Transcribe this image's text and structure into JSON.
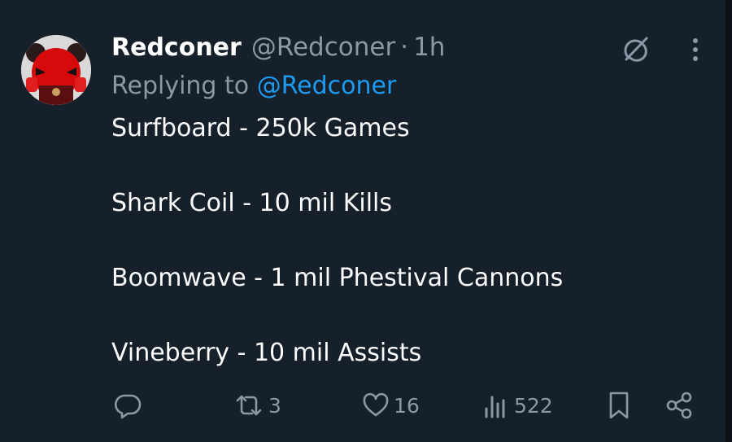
{
  "post": {
    "display_name": "Redconer",
    "handle": "@Redconer",
    "separator": "·",
    "time": "1h",
    "reply_prefix": "Replying to",
    "reply_handle": "@Redconer",
    "lines": [
      "Surfboard - 250k Games",
      "Shark Coil - 10 mil Kills",
      "Boomwave - 1 mil Phestival Cannons",
      "Vineberry - 10 mil Assists"
    ]
  },
  "actions": {
    "replies_count": "",
    "reposts_count": "3",
    "likes_count": "16",
    "views_count": "522"
  },
  "icons": {
    "top_right": [
      "grok-icon",
      "more-icon"
    ],
    "bottom": [
      "reply-icon",
      "repost-icon",
      "like-icon",
      "views-icon",
      "bookmark-icon",
      "share-icon"
    ]
  },
  "colors": {
    "background": "#15202b",
    "primary_text": "#ffffff",
    "secondary_text": "#8b98a5",
    "link": "#1d9bf0"
  }
}
